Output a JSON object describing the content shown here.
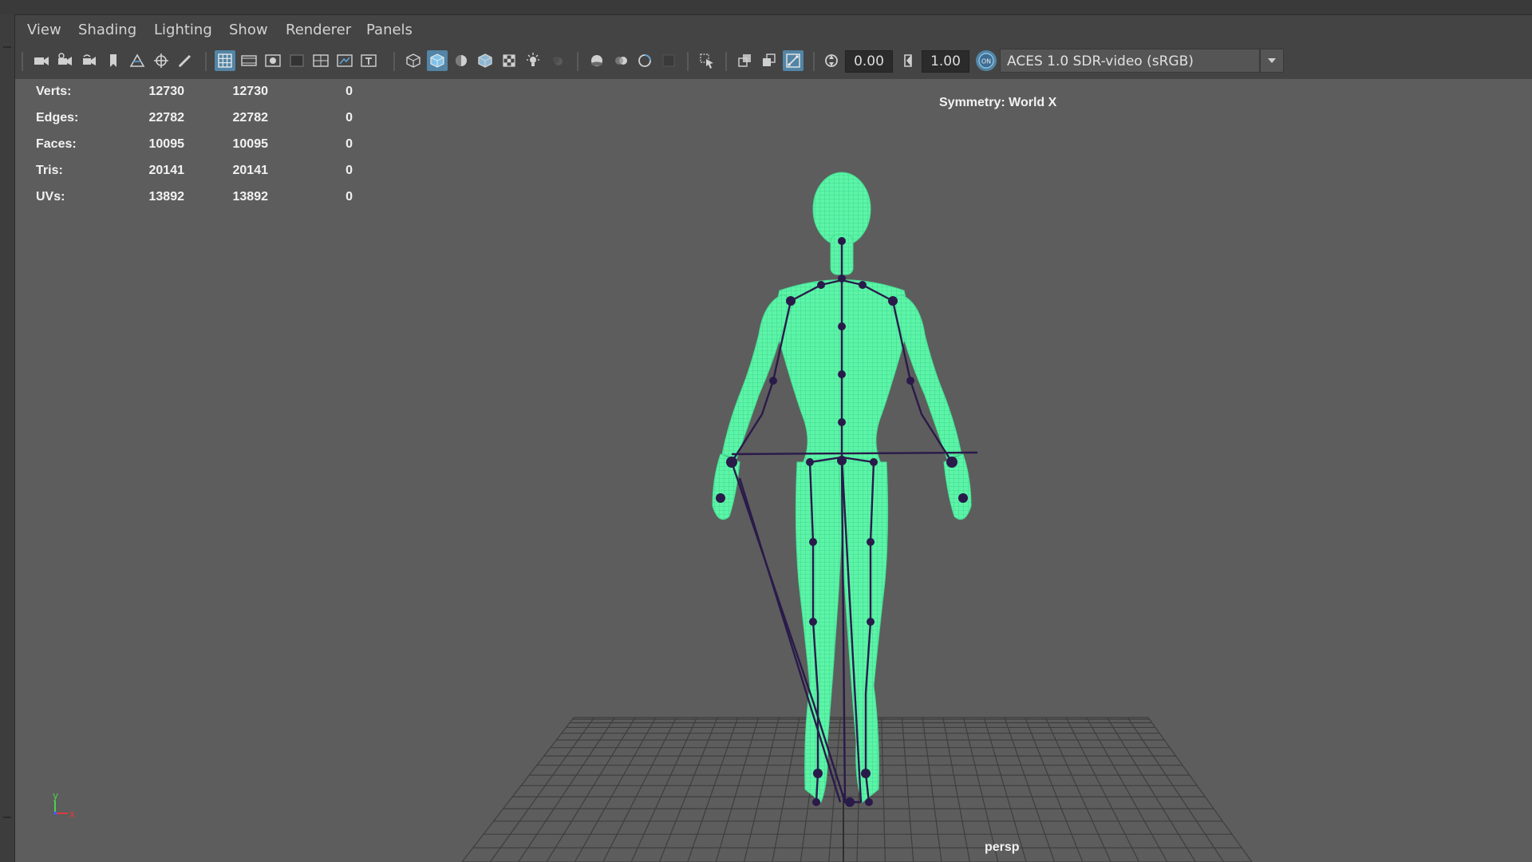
{
  "menu": {
    "items": [
      "View",
      "Shading",
      "Lighting",
      "Show",
      "Renderer",
      "Panels"
    ]
  },
  "toolbar": {
    "exposure_value": "0.00",
    "gamma_value": "1.00",
    "color_management_label": "ACES 1.0 SDR-video (sRGB)",
    "icons": [
      "camera-icon",
      "camera-attributes-icon",
      "camera-bookmark-icon",
      "bookmark-icon",
      "image-plane-icon",
      "2d-pan-zoom-icon",
      "grease-pencil-icon",
      "grid-icon",
      "film-gate-icon",
      "resolution-gate-icon",
      "gate-mask-icon",
      "field-chart-icon",
      "safe-action-icon",
      "safe-title-icon",
      "wireframe-icon",
      "smooth-shade-icon",
      "default-material-icon",
      "wireframe-on-shaded-icon",
      "textured-icon",
      "use-all-lights-icon",
      "shadows-icon",
      "screen-space-ao-icon",
      "motion-blur-icon",
      "anti-aliasing-icon",
      "depth-of-field-icon",
      "isolate-select-icon",
      "xray-icon",
      "xray-active-components-icon",
      "xray-joints-icon",
      "exposure-icon",
      "gamma-icon",
      "color-management-icon"
    ]
  },
  "hud": {
    "stats": [
      {
        "label": "Verts:",
        "values": [
          "12730",
          "12730",
          "0"
        ]
      },
      {
        "label": "Edges:",
        "values": [
          "22782",
          "22782",
          "0"
        ]
      },
      {
        "label": "Faces:",
        "values": [
          "10095",
          "10095",
          "0"
        ]
      },
      {
        "label": "Tris:",
        "values": [
          "20141",
          "20141",
          "0"
        ]
      },
      {
        "label": "UVs:",
        "values": [
          "13892",
          "13892",
          "0"
        ]
      }
    ],
    "symmetry": "Symmetry: World X",
    "camera": "persp",
    "axis_x": "x",
    "axis_y": "y"
  },
  "colors": {
    "mesh": "#5cf5a8",
    "joints": "#2a1a4a",
    "viewport_bg": "#5d5d5d",
    "grid": "#3e3e3e",
    "active_button": "#5285a6"
  }
}
